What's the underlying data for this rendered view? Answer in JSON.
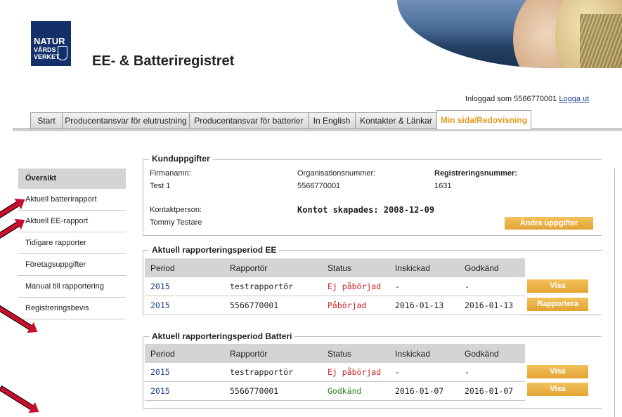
{
  "header": {
    "logo_line1": "NATUR",
    "logo_line2": "VÅRDS",
    "logo_line3": "VERKET",
    "site_title": "EE- & Batteriregistret",
    "login_text": "Inloggad som 5566770001",
    "logout_label": "Logga ut"
  },
  "tabs": [
    {
      "label": "Start"
    },
    {
      "label": "Producentansvar för elutrustning"
    },
    {
      "label": "Producentansvar för batterier"
    },
    {
      "label": "In English"
    },
    {
      "label": "Kontakter & Länkar"
    },
    {
      "label": "Min sida/Redovisning",
      "active": true
    }
  ],
  "sidebar": {
    "items": [
      {
        "label": "Översikt"
      },
      {
        "label": "Aktuell batterirapport"
      },
      {
        "label": "Aktuell EE-rapport"
      },
      {
        "label": "Tidigare rapporter"
      },
      {
        "label": "Företagsuppgifter"
      },
      {
        "label": "Manual till rapportering"
      },
      {
        "label": "Registreringsbevis"
      }
    ]
  },
  "customer": {
    "legend": "Kunduppgifter",
    "company_label": "Firmanamn:",
    "company_value": "Test 1",
    "org_label": "Organisationsnummer:",
    "org_value": "5566770001",
    "reg_label": "Registreringsnummer:",
    "reg_value": "1631",
    "contact_label": "Kontaktperson:",
    "contact_value": "Tommy Testare",
    "created_text": "Kontot skapades: 2008-12-09",
    "edit_button": "Ändra uppgifter"
  },
  "ee_period": {
    "legend": "Aktuell rapporteringsperiod EE",
    "columns": [
      "Period",
      "Rapportör",
      "Status",
      "Inskickad",
      "Godkänd"
    ],
    "rows": [
      {
        "period": "2015",
        "reporter": "testrapportör",
        "status": "Ej påbörjad",
        "status_color": "#cc1f1f",
        "sent": "-",
        "approved": "-",
        "action": "Visa"
      },
      {
        "period": "2015",
        "reporter": "5566770001",
        "status": "Påbörjad",
        "status_color": "#cc1f1f",
        "sent": "2016-01-13",
        "approved": "2016-01-13",
        "action": "Rapportera"
      }
    ]
  },
  "battery_period": {
    "legend": "Aktuell rapporteringsperiod Batteri",
    "columns": [
      "Period",
      "Rapportör",
      "Status",
      "Inskickad",
      "Godkänd"
    ],
    "rows": [
      {
        "period": "2015",
        "reporter": "testrapportör",
        "status": "Ej påbörjad",
        "status_color": "#cc1f1f",
        "sent": "-",
        "approved": "-",
        "action": "Visa"
      },
      {
        "period": "2015",
        "reporter": "5566770001",
        "status": "Godkänd",
        "status_color": "#2e7d1e",
        "sent": "2016-01-07",
        "approved": "2016-01-07",
        "action": "Visa"
      }
    ]
  },
  "colors": {
    "accent_orange": "#e39a1e",
    "link_blue": "#1a3e8c",
    "arrow_red": "#c8102e"
  }
}
